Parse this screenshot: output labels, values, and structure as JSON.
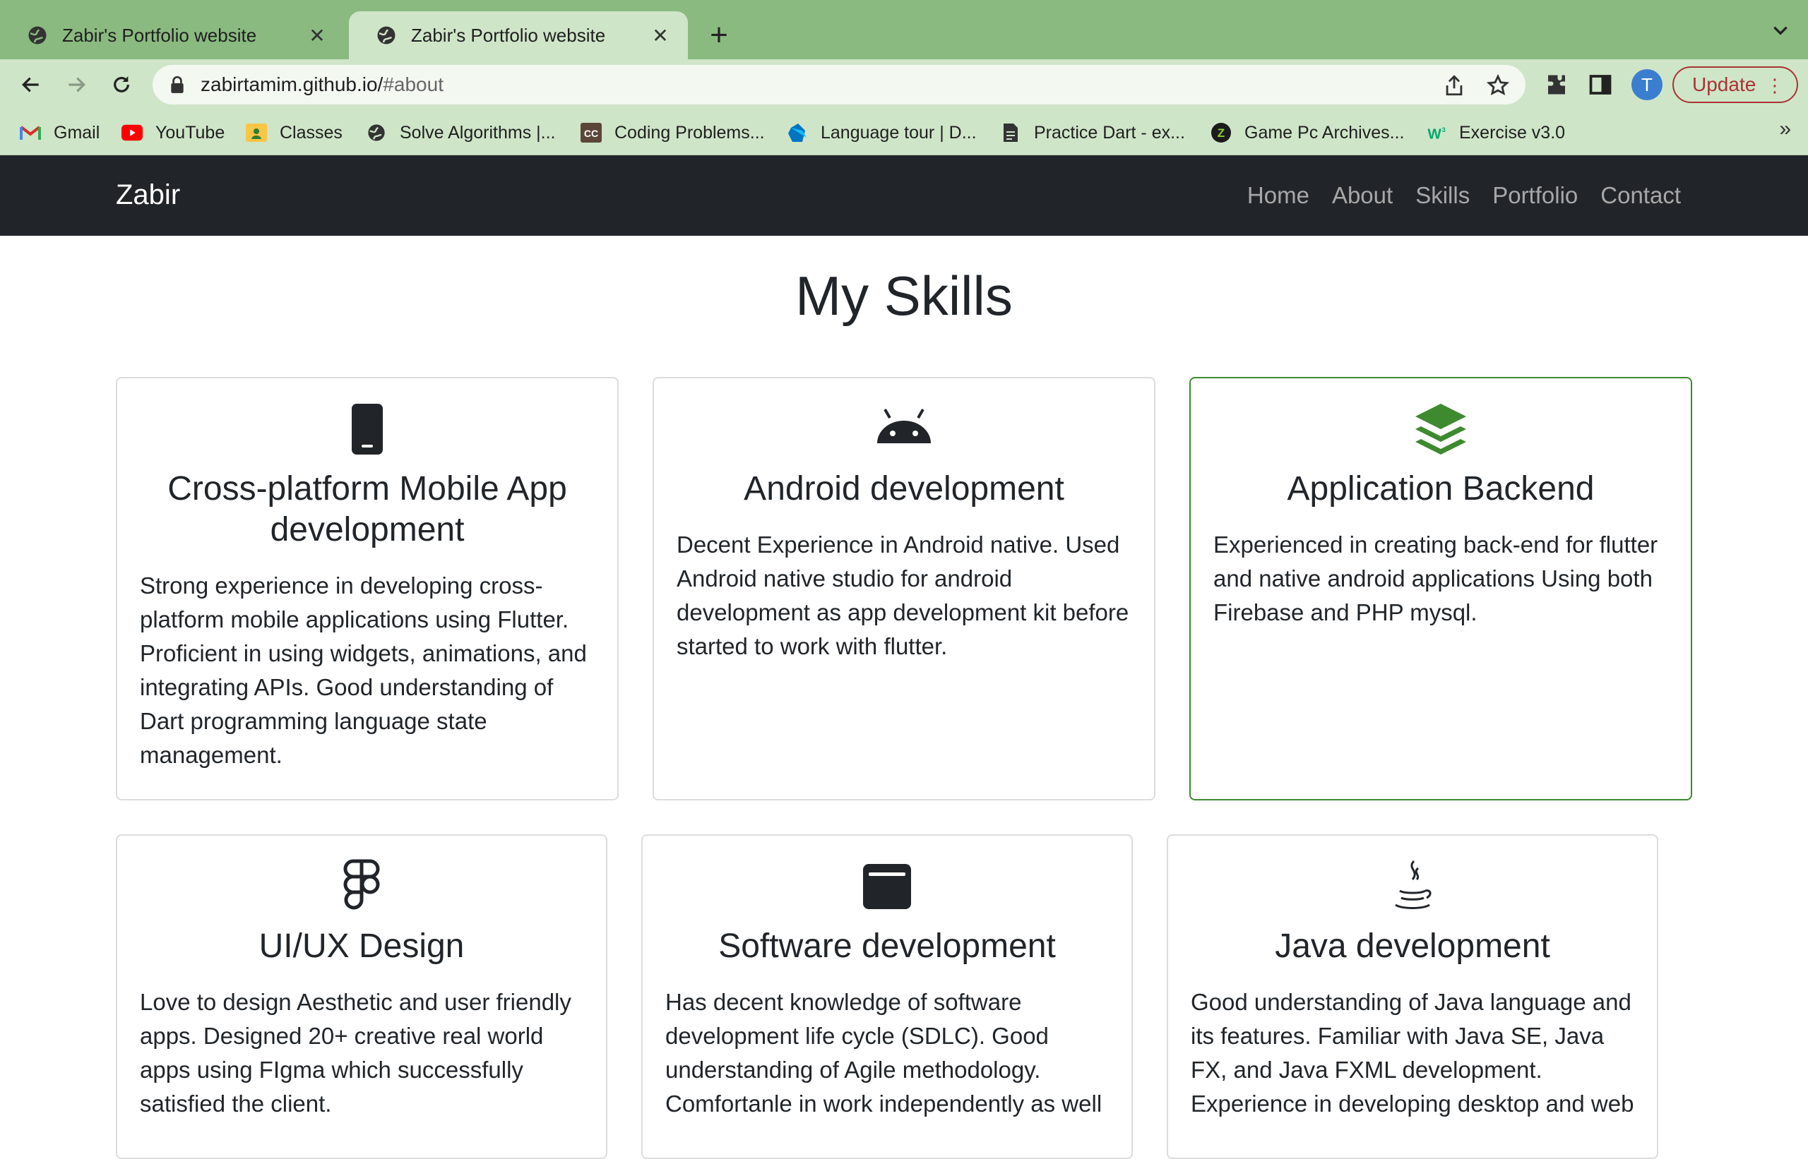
{
  "browser": {
    "tabs": [
      {
        "title": "Zabir's Portfolio website",
        "active": false
      },
      {
        "title": "Zabir's Portfolio website",
        "active": true
      }
    ],
    "url_host": "zabirtamim.github.io/",
    "url_path": "#about",
    "avatar_letter": "T",
    "update_label": "Update",
    "bookmarks": [
      {
        "label": "Gmail",
        "icon": "gmail-icon"
      },
      {
        "label": "YouTube",
        "icon": "youtube-icon"
      },
      {
        "label": "Classes",
        "icon": "classroom-icon"
      },
      {
        "label": "Solve Algorithms |...",
        "icon": "globe-icon"
      },
      {
        "label": "Coding Problems...",
        "icon": "codechef-icon"
      },
      {
        "label": "Language tour | D...",
        "icon": "dart-icon"
      },
      {
        "label": "Practice Dart - ex...",
        "icon": "document-icon"
      },
      {
        "label": "Game Pc Archives...",
        "icon": "game-icon"
      },
      {
        "label": "Exercise v3.0",
        "icon": "w3schools-icon"
      }
    ]
  },
  "site": {
    "brand": "Zabir",
    "nav": [
      "Home",
      "About",
      "Skills",
      "Portfolio",
      "Contact"
    ],
    "heading": "My Skills",
    "accent_color": "#3d8a2f",
    "skills": [
      {
        "icon": "phone-icon",
        "title": "Cross-platform Mobile App development",
        "description": "Strong experience in developing cross-platform mobile applications using Flutter. Proficient in using widgets, animations, and integrating APIs. Good understanding of Dart programming language state management."
      },
      {
        "icon": "android-icon",
        "title": "Android development",
        "description": "Decent Experience in Android native. Used Android native studio for android development as app development kit before started to work with flutter."
      },
      {
        "icon": "layers-icon",
        "title": "Application Backend",
        "description": "Experienced in creating back-end for flutter and native android applications Using both Firebase and PHP mysql."
      },
      {
        "icon": "figma-icon",
        "title": "UI/UX Design",
        "description": "Love to design Aesthetic and user friendly apps. Designed 20+ creative real world apps using FIgma which successfully satisfied the client."
      },
      {
        "icon": "window-icon",
        "title": "Software development",
        "description": "Has decent knowledge of software development life cycle (SDLC). Good understanding of Agile methodology. Comfortanle in work independently as well"
      },
      {
        "icon": "java-icon",
        "title": "Java development",
        "description": "Good understanding of Java language and its features. Familiar with Java SE, Java FX, and Java FXML development. Experience in developing desktop and web"
      }
    ]
  }
}
